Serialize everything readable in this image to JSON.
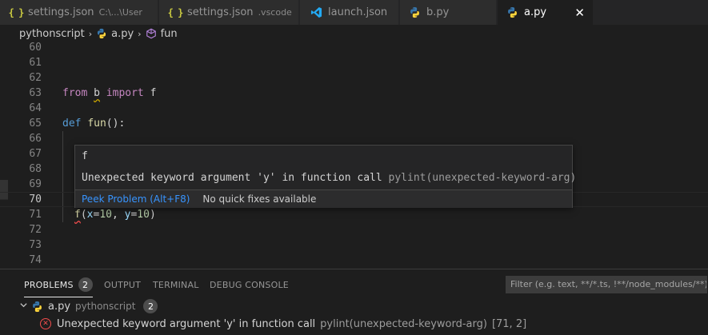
{
  "tabs": [
    {
      "label": "settings.json",
      "description": "C:\\...\\User",
      "icon": "json-braces-icon",
      "active": false
    },
    {
      "label": "settings.json",
      "description": ".vscode",
      "icon": "json-braces-icon",
      "active": false
    },
    {
      "label": "launch.json",
      "description": "",
      "icon": "vscode-logo-icon",
      "active": false
    },
    {
      "label": "b.py",
      "description": "",
      "icon": "python-icon",
      "active": false
    },
    {
      "label": "a.py",
      "description": "",
      "icon": "python-icon",
      "active": true,
      "close": "✕"
    }
  ],
  "json_icon_glyph": "{ }",
  "breadcrumb": {
    "folder": "pythonscript",
    "file": "a.py",
    "symbol": "fun",
    "separator": "›"
  },
  "editor": {
    "line_numbers": [
      "60",
      "61",
      "62",
      "63",
      "64",
      "65",
      "66",
      "67",
      "68",
      "69",
      "70",
      "71",
      "72",
      "73",
      "74"
    ],
    "current_line": "70",
    "code": {
      "l63_from": "from",
      "l63_b": "b",
      "l63_import": "import",
      "l63_f": "f",
      "l65_def": "def",
      "l65_fun": "fun",
      "l65_rest": "():",
      "l71_f": "f",
      "l71_open": "(",
      "l71_x": "x",
      "l71_eq1": "=",
      "l71_10a": "10",
      "l71_comma": ", ",
      "l71_y": "y",
      "l71_eq2": "=",
      "l71_10b": "10",
      "l71_close": ")"
    }
  },
  "hover": {
    "symbol": "f",
    "message": "Unexpected keyword argument 'y' in function call",
    "source": "pylint(unexpected-keyword-arg)",
    "peek_label": "Peek Problem (Alt+F8)",
    "no_fix_label": "No quick fixes available"
  },
  "panel": {
    "tabs": {
      "problems": "PROBLEMS",
      "problems_count": "2",
      "output": "OUTPUT",
      "terminal": "TERMINAL",
      "debug_console": "DEBUG CONSOLE"
    },
    "filter_placeholder": "Filter (e.g. text, **/*.ts, !**/node_modules/**)",
    "file_row": {
      "chevron": "❯",
      "file": "a.py",
      "folder": "pythonscript",
      "count": "2"
    },
    "problem": {
      "message": "Unexpected keyword argument 'y' in function call",
      "source": "pylint(unexpected-keyword-arg)",
      "location": "[71, 2]"
    }
  },
  "colors": {
    "editor_bg": "#1e1e1e",
    "tab_bg": "#2d2d2d",
    "keyword": "#c586c0",
    "error": "#f14c4c",
    "link": "#3794ff",
    "json_icon": "#cbcb41",
    "python_blue": "#3776ab",
    "python_yellow": "#ffd43b",
    "vscode_blue": "#23a9f2"
  }
}
